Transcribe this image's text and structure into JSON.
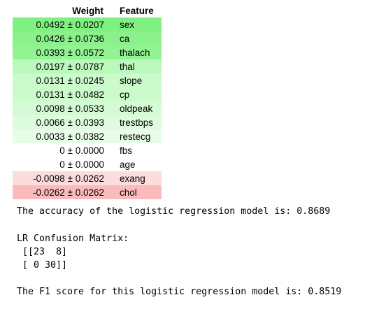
{
  "weights_table": {
    "headers": {
      "weight": "Weight",
      "feature": "Feature"
    },
    "rows": [
      {
        "weight": "0.0492 ± 0.0207",
        "feature": "sex",
        "color": "#80f080"
      },
      {
        "weight": "0.0426 ± 0.0736",
        "feature": "ca",
        "color": "#8bf28b"
      },
      {
        "weight": "0.0393 ± 0.0572",
        "feature": "thalach",
        "color": "#91f391"
      },
      {
        "weight": "0.0197 ± 0.0787",
        "feature": "thal",
        "color": "#bbf8bb"
      },
      {
        "weight": "0.0131 ± 0.0245",
        "feature": "slope",
        "color": "#cbfacb"
      },
      {
        "weight": "0.0131 ± 0.0482",
        "feature": "cp",
        "color": "#cbfacb"
      },
      {
        "weight": "0.0098 ± 0.0533",
        "feature": "oldpeak",
        "color": "#d4fbd4"
      },
      {
        "weight": "0.0066 ± 0.0393",
        "feature": "trestbps",
        "color": "#ddfcdd"
      },
      {
        "weight": "0.0033 ± 0.0382",
        "feature": "restecg",
        "color": "#e8fde8"
      },
      {
        "weight": "0 ± 0.0000",
        "feature": "fbs",
        "color": "#ffffff"
      },
      {
        "weight": "0 ± 0.0000",
        "feature": "age",
        "color": "#ffffff"
      },
      {
        "weight": "-0.0098 ± 0.0262",
        "feature": "exang",
        "color": "#fcdcdc"
      },
      {
        "weight": "-0.0262 ± 0.0262",
        "feature": "chol",
        "color": "#fbbbbb"
      }
    ]
  },
  "output": {
    "accuracy_line": "The accuracy of the logistic regression model is: 0.8689",
    "confusion_title": "LR Confusion Matrix:",
    "confusion_row1": " [[23  8]",
    "confusion_row2": " [ 0 30]]",
    "f1_line": "The F1 score for this logistic regression model is: 0.8519"
  }
}
